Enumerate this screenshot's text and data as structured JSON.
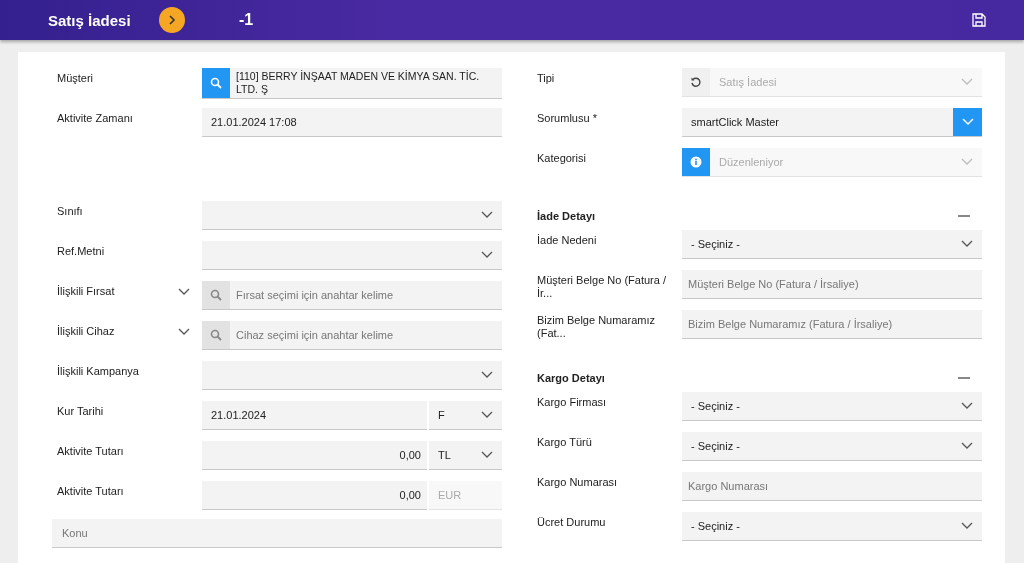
{
  "header": {
    "title": "Satış İadesi",
    "record_no": "-1"
  },
  "left": [
    {
      "label": "Müşteri",
      "kind": "lookup",
      "icon_active": true,
      "value": "[110] BERRY İNŞAAT MADEN VE KİMYA SAN. TİC. LTD. Ş"
    },
    {
      "label": "Aktivite Zamanı",
      "kind": "text",
      "value": "21.01.2024 17:08"
    },
    {
      "label": "Sınıfı",
      "kind": "select"
    },
    {
      "label": "Ref.Metni",
      "kind": "select"
    },
    {
      "label": "İlişkili Fırsat",
      "kind": "lookup",
      "icon_active": false,
      "expandable": true,
      "placeholder": "Fırsat seçimi için anahtar kelime"
    },
    {
      "label": "İlişkili Cihaz",
      "kind": "lookup",
      "icon_active": false,
      "expandable": true,
      "placeholder": "Cihaz seçimi için anahtar kelime"
    },
    {
      "label": "İlişkili Kampanya",
      "kind": "select"
    },
    {
      "label": "Kur Tarihi",
      "kind": "split",
      "value": "21.01.2024",
      "unit": "F",
      "unit_disabled": false
    },
    {
      "label": "Aktivite Tutarı",
      "kind": "split",
      "value": "0,00",
      "numeric": true,
      "unit": "TL",
      "unit_disabled": false
    },
    {
      "label": "Aktivite Tutarı",
      "kind": "split",
      "value": "0,00",
      "numeric": true,
      "unit": "EUR",
      "unit_disabled": true
    }
  ],
  "subject": {
    "placeholder": "Konu"
  },
  "right": [
    {
      "label": "Tipi",
      "kind": "undo_select",
      "icon_active": false,
      "value": "Satış İadesi",
      "disabled": true
    },
    {
      "label": "Sorumlusu *",
      "kind": "select",
      "blue_button": true,
      "value": "smartClick Master"
    },
    {
      "label": "Kategorisi",
      "kind": "info_select",
      "icon_active": true,
      "value": "Düzenleniyor",
      "disabled": true
    }
  ],
  "sections": [
    {
      "title": "İade Detayı",
      "expanded": true,
      "rows": [
        {
          "label": "İade Nedeni",
          "kind": "select",
          "value": "- Seçiniz -"
        },
        {
          "label": "Müşteri Belge No (Fatura / İr...",
          "kind": "text",
          "placeholder": "Müşteri Belge No (Fatura / İrsaliye)"
        },
        {
          "label": "Bizim Belge Numaramız (Fat...",
          "kind": "text",
          "placeholder": "Bizim Belge Numaramız (Fatura / İrsaliye)"
        }
      ]
    },
    {
      "title": "Kargo Detayı",
      "expanded": true,
      "rows": [
        {
          "label": "Kargo Firması",
          "kind": "select",
          "value": "- Seçiniz -"
        },
        {
          "label": "Kargo Türü",
          "kind": "select",
          "value": "- Seçiniz -"
        },
        {
          "label": "Kargo Numarası",
          "kind": "text",
          "placeholder": "Kargo Numarası"
        },
        {
          "label": "Ücret Durumu",
          "kind": "select",
          "value": "- Seçiniz -"
        }
      ]
    }
  ]
}
